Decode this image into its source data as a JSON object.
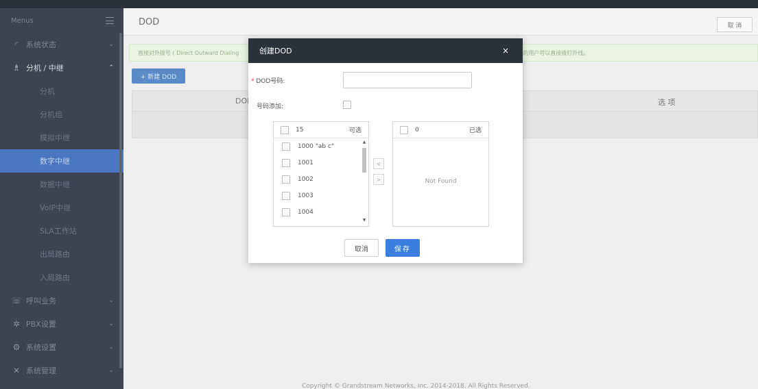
{
  "sidebar": {
    "title": "Menus",
    "items": [
      {
        "label": "系统状态",
        "icon": "gauge-icon",
        "glyph": "◜"
      },
      {
        "label": "分机 / 中继",
        "icon": "network-icon",
        "glyph": "♗"
      },
      {
        "label": "呼叫业务",
        "icon": "phone-icon",
        "glyph": "☏"
      },
      {
        "label": "PBX设置",
        "icon": "gear-icon",
        "glyph": "✲"
      },
      {
        "label": "系统设置",
        "icon": "settings-icon",
        "glyph": "⚙"
      },
      {
        "label": "系统管理",
        "icon": "tools-icon",
        "glyph": "✕"
      }
    ],
    "subitems": [
      "分机",
      "分机组",
      "模拟中继",
      "数字中继",
      "数据中继",
      "VoIP中继",
      "SLA工作站",
      "出局路由",
      "入局路由"
    ],
    "active_subitem": "数字中继"
  },
  "main": {
    "page_title": "DOD",
    "cancel_label": "取 消",
    "notice": "直接对外拨号 ( Direct Outward Dialing",
    "notice_tail": "内部的用户可以直接拨打外线。",
    "new_button": "+ 新建 DOD",
    "columns": [
      "DOD",
      "选 项"
    ],
    "copyright": "Copyright © Grandstream Networks, Inc. 2014-2018. All Rights Reserved."
  },
  "modal": {
    "title": "创建DOD",
    "close_glyph": "×",
    "dod_required_mark": "*",
    "dod_label": "DOD号码:",
    "add_label": "号码添加:",
    "available": {
      "count": "15",
      "label": "可选",
      "items": [
        "1000 \"ab c\"",
        "1001",
        "1002",
        "1003",
        "1004"
      ]
    },
    "selected": {
      "count": "0",
      "label": "已选",
      "empty_text": "Not Found"
    },
    "move_left_glyph": "<",
    "move_right_glyph": ">",
    "cancel_label": "取消",
    "save_label": "保存"
  },
  "colors": {
    "sidebar_bg": "#3d4450",
    "active_item": "#4b76c2",
    "modal_header": "#2b3138",
    "primary_button": "#3a7fe0"
  }
}
